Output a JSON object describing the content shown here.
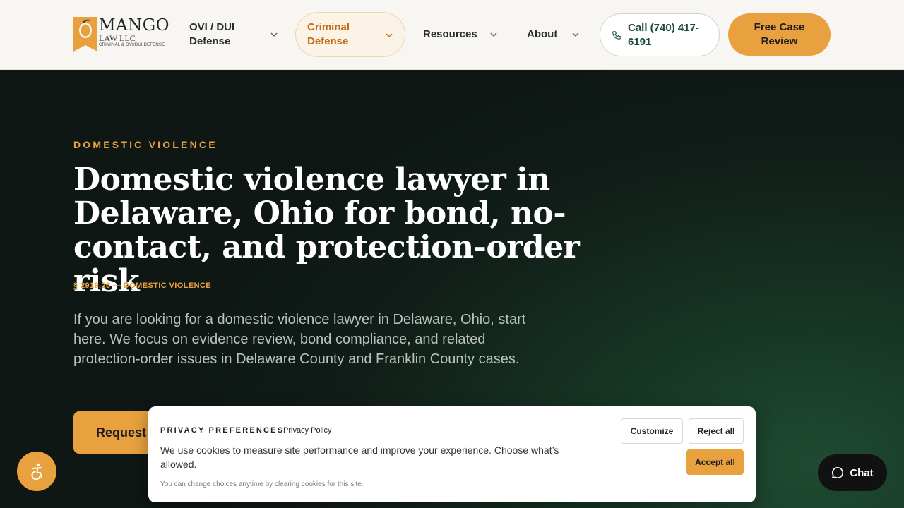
{
  "header": {
    "logo": {
      "name": "MANGO",
      "sub": "LAW LLC",
      "tagline": "CRIMINAL & OVI/DUI DEFENSE"
    },
    "nav": [
      {
        "label": "OVI / DUI Defense",
        "active": false
      },
      {
        "label": "Criminal Defense",
        "active": true
      },
      {
        "label": "Resources",
        "active": false
      },
      {
        "label": "About",
        "active": false
      }
    ],
    "call_label": "Call (740) 417-6191",
    "cta_label": "Free Case Review"
  },
  "hero": {
    "eyebrow": "DOMESTIC VIOLENCE",
    "title": "Domestic violence lawyer in Delaware, Ohio for bond, no-contact, and protection-order risk",
    "statute": "§ 2919.25 — DOMESTIC VIOLENCE",
    "lead": "If you are looking for a domestic violence lawyer in Delaware, Ohio, start here. We focus on evidence review, bond compliance, and related protection-order issues in Delaware County and Franklin County cases.",
    "cta_label": "Request"
  },
  "cookie": {
    "title": "PRIVACY PREFERENCES",
    "policy_link": "Privacy Policy",
    "body": "We use cookies to measure site performance and improve your experience. Choose what’s allowed.",
    "note": "You can change choices anytime by clearing cookies for this site.",
    "customize_label": "Customize",
    "reject_label": "Reject all",
    "accept_label": "Accept all"
  },
  "chat_label": "Chat",
  "colors": {
    "accent": "#e8a13e",
    "accent_text": "#c46b14",
    "dark_green": "#1e4a3b",
    "hero_bg": "#111d18"
  },
  "icons": {
    "nav_chevron": "chevron-down-icon",
    "phone": "phone-icon",
    "accessibility": "accessibility-icon",
    "chat": "chat-bubble-icon"
  }
}
